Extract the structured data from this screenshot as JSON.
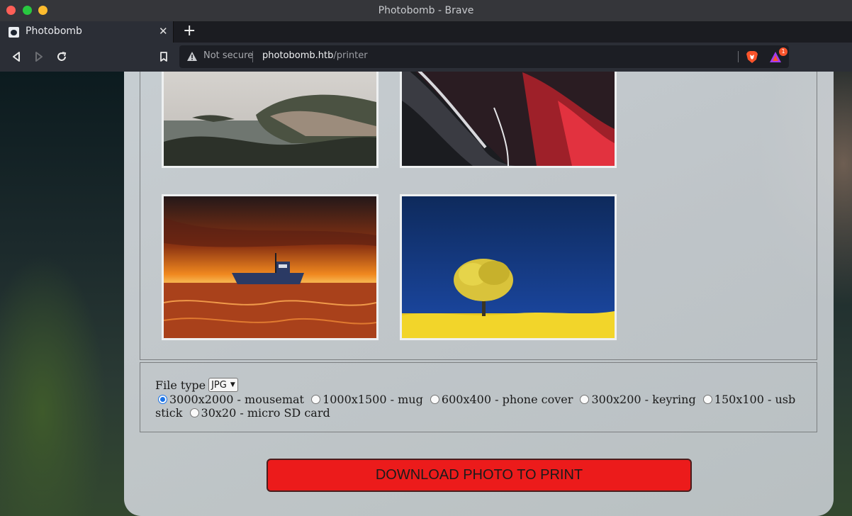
{
  "window": {
    "title": "Photobomb - Brave"
  },
  "tabs": [
    {
      "title": "Photobomb",
      "close": "✕"
    }
  ],
  "new_tab": "+",
  "toolbar": {
    "security_label": "Not secure",
    "url_host": "photobomb.htb",
    "url_path": "/printer",
    "rewards_badge": "1"
  },
  "gallery": {
    "photos": [
      {
        "name": "coastal-cliffs"
      },
      {
        "name": "red-machinery-closeup"
      },
      {
        "name": "boat-at-sunset"
      },
      {
        "name": "yellow-tree-blue-sky"
      }
    ]
  },
  "options": {
    "filetype_label": "File type",
    "filetype_selected": "JPG",
    "sizes": [
      {
        "label": "3000x2000 - mousemat",
        "checked": true
      },
      {
        "label": "1000x1500 - mug",
        "checked": false
      },
      {
        "label": "600x400 - phone cover",
        "checked": false
      },
      {
        "label": "300x200 - keyring",
        "checked": false
      },
      {
        "label": "150x100 - usb stick",
        "checked": false
      },
      {
        "label": "30x20 - micro SD card",
        "checked": false
      }
    ]
  },
  "download_button": "DOWNLOAD PHOTO TO PRINT"
}
